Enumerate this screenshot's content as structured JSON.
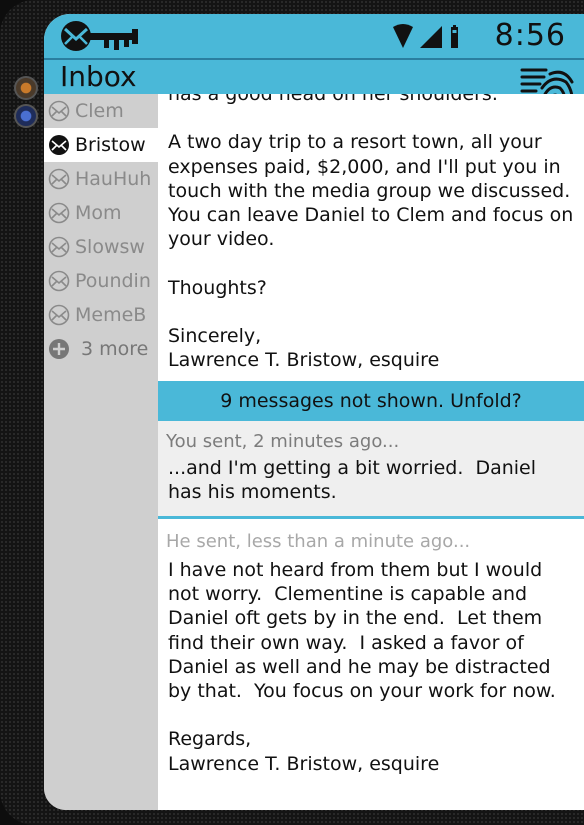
{
  "status_bar": {
    "time": "8:56",
    "icons": [
      "wifi-icon",
      "signal-icon",
      "battery-icon"
    ]
  },
  "header": {
    "title": "Inbox",
    "fingerprint_icon": "fingerprint-icon"
  },
  "sidebar": {
    "items": [
      {
        "label": "Clem",
        "icon": "mail-icon"
      },
      {
        "label": "Bristow",
        "icon": "mail-icon",
        "active": true
      },
      {
        "label": "HauHuh",
        "icon": "mail-icon"
      },
      {
        "label": "Mom",
        "icon": "mail-icon"
      },
      {
        "label": "Slowsw",
        "icon": "mail-icon"
      },
      {
        "label": "Poundin",
        "icon": "mail-icon"
      },
      {
        "label": "MemeB",
        "icon": "mail-icon"
      }
    ],
    "more": {
      "label": "3 more",
      "icon": "plus-circle-icon"
    }
  },
  "thread": {
    "message1": {
      "body": "has a good head on her shoulders.\n\nA two day trip to a resort town, all your expenses paid, $2,000, and I'll put you in touch with the media group we discussed.  You can leave Daniel to Clem and focus on your video.\n\nThoughts?\n\nSincerely,\nLawrence T. Bristow, esquire"
    },
    "fold_banner": "9 messages not shown.  Unfold?",
    "message2": {
      "sender": "You sent, 2 minutes ago...",
      "body": "...and I'm getting a bit worried.  Daniel has his moments."
    },
    "message3": {
      "sender": "He sent, less than a minute ago...",
      "body": "I have not heard from them but I would not worry.  Clementine is capable and Daniel oft gets by in the end.  Let them find their own way.  I asked a favor of Daniel as well and he may be distracted by that.  You focus on your work for now.\n\nRegards,\nLawrence T. Bristow, esquire"
    }
  },
  "colors": {
    "accent": "#4ab8d8",
    "sidebar_bg": "#cfcfcf",
    "sidebar_text": "#8a8a8a",
    "text": "#111111",
    "sender_text": "#7c7c7c"
  }
}
